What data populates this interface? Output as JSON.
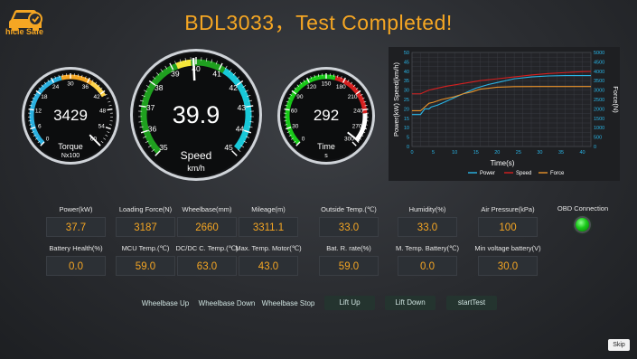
{
  "app": {
    "logo_text": "hicle Safe",
    "title": "BDL3033，Test Completed!"
  },
  "gauges": {
    "torque": {
      "value": "3429",
      "label": "Torque",
      "unit": "Nx100",
      "ticks": [
        "0",
        "6",
        "12",
        "18",
        "24",
        "30",
        "36",
        "42",
        "48",
        "54",
        "60"
      ]
    },
    "speed": {
      "value": "39.9",
      "label": "Speed",
      "unit": "km/h",
      "ticks": [
        "35",
        "36",
        "37",
        "38",
        "39",
        "40",
        "41",
        "42",
        "43",
        "44",
        "45"
      ]
    },
    "time": {
      "value": "292",
      "label": "Time",
      "unit": "s",
      "ticks": [
        "0",
        "30",
        "60",
        "90",
        "120",
        "150",
        "180",
        "210",
        "240",
        "270",
        "300"
      ]
    }
  },
  "chart_data": {
    "type": "line",
    "xlabel": "Time(s)",
    "ylabel_left": "Power(kW) Speed(km/h)",
    "ylabel_right": "Force(N)",
    "x_ticks": [
      "0",
      "5",
      "10",
      "15",
      "20",
      "25",
      "30",
      "35",
      "40"
    ],
    "y_left_ticks": [
      "0",
      "5",
      "10",
      "15",
      "20",
      "25",
      "30",
      "35",
      "40",
      "45",
      "50"
    ],
    "y_right_ticks": [
      "0",
      "500",
      "1000",
      "1500",
      "2000",
      "2500",
      "3000",
      "3500",
      "4000",
      "4500",
      "5000"
    ],
    "xlim": [
      0,
      42
    ],
    "ylim_left": [
      0,
      50
    ],
    "ylim_right": [
      0,
      5000
    ],
    "legend_position": "bottom",
    "series": [
      {
        "name": "Power",
        "color": "#29b6e8",
        "axis": "left",
        "x": [
          0,
          2,
          3,
          4,
          4.5,
          6,
          8,
          10,
          12,
          15,
          18,
          20,
          24,
          28,
          32,
          36,
          40,
          42
        ],
        "y": [
          17,
          17,
          20,
          20,
          21,
          22,
          24,
          26,
          28,
          31,
          33,
          34,
          36,
          37,
          37.5,
          37.7,
          37.7,
          37.7
        ]
      },
      {
        "name": "Speed",
        "color": "#d62020",
        "axis": "left",
        "x": [
          0,
          2,
          4,
          5,
          8,
          12,
          16,
          20,
          24,
          28,
          32,
          36,
          40,
          42
        ],
        "y": [
          28,
          28,
          30,
          30.5,
          32,
          33.5,
          35,
          36,
          37,
          38,
          38.8,
          39.3,
          39.8,
          39.9
        ]
      },
      {
        "name": "Force",
        "color": "#e8922a",
        "axis": "right",
        "x": [
          0,
          2,
          3,
          4,
          5,
          7,
          10,
          12,
          14,
          16,
          18,
          20,
          24,
          30,
          36,
          42
        ],
        "y": [
          1900,
          1900,
          2100,
          2300,
          2350,
          2500,
          2650,
          2800,
          2900,
          3050,
          3100,
          3150,
          3180,
          3187,
          3187,
          3187
        ]
      }
    ]
  },
  "metrics": [
    {
      "label": "Power(kW)",
      "value": "37.7"
    },
    {
      "label": "Loading Force(N)",
      "value": "3187"
    },
    {
      "label": "Wheelbase(mm)",
      "value": "2660"
    },
    {
      "label": "Mileage(m)",
      "value": "3311.1"
    },
    {
      "label": "Outside Temp.(℃)",
      "value": "33.0"
    },
    {
      "label": "Humidity(%)",
      "value": "33.0"
    },
    {
      "label": "Air Pressure(kPa)",
      "value": "100"
    },
    {
      "label": "Battery Health(%)",
      "value": "0.0"
    },
    {
      "label": "MCU Temp.(℃)",
      "value": "59.0"
    },
    {
      "label": "DC/DC C. Temp.(℃)",
      "value": "63.0"
    },
    {
      "label": "Max. Temp. Motor(℃)",
      "value": "43.0"
    },
    {
      "label": "Bat. R. rate(%)",
      "value": "59.0"
    },
    {
      "label": "M. Temp. Battery(℃)",
      "value": "0.0"
    },
    {
      "label": "Min voltage battery(V)",
      "value": "30.0"
    }
  ],
  "obd": {
    "label": "OBD Connection",
    "status_color": "#19c919"
  },
  "buttons": {
    "wheelbase_up": "Wheelbase Up",
    "wheelbase_down": "Wheelbase Down",
    "wheelbase_stop": "Wheelbase Stop",
    "lift_up": "Lift Up",
    "lift_down": "Lift Down",
    "start_test": "startTest",
    "skip": "Skip"
  }
}
